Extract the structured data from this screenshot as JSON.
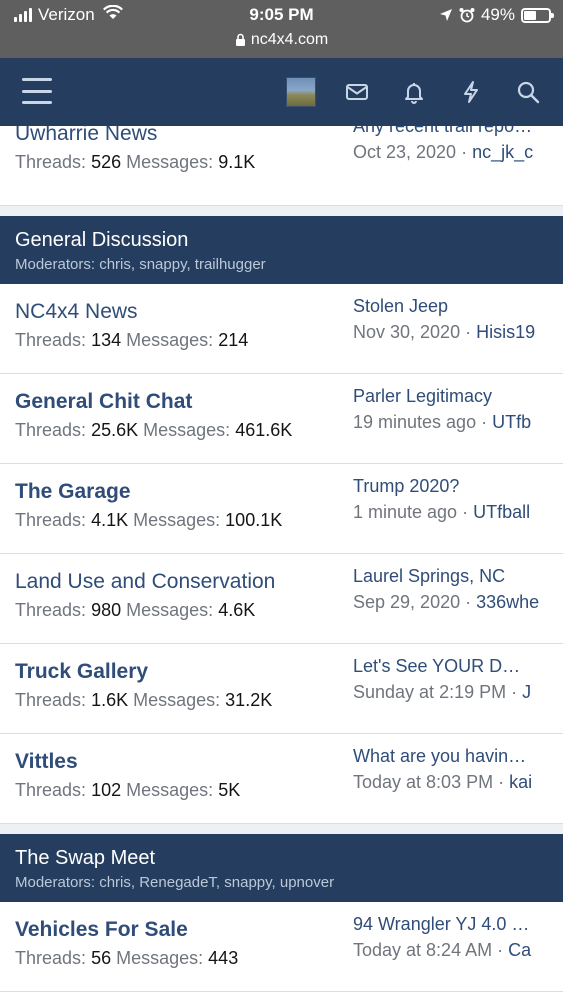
{
  "status_bar": {
    "carrier": "Verizon",
    "time": "9:05 PM",
    "url": "nc4x4.com",
    "battery": "49%",
    "battery_level": 0.49
  },
  "navbar": {
    "icons": [
      "menu-icon",
      "avatar",
      "inbox-icon",
      "bell-icon",
      "bolt-icon",
      "search-icon"
    ]
  },
  "colors": {
    "header_bg": "#253e60",
    "link": "#2f4d78",
    "muted": "#70757d",
    "status_bg": "#5f5f5f"
  },
  "labels": {
    "threads": "Threads:",
    "messages": "Messages:"
  },
  "forums_top": [
    {
      "title": "Uwharrie News",
      "threads": "526",
      "messages": "9.1K",
      "last_title": "Any recent trail repo…",
      "last_date": "Oct 23, 2020",
      "last_user": "nc_jk_c"
    }
  ],
  "categories": [
    {
      "title": "General Discussion",
      "moderators": "Moderators: chris, snappy, trailhugger",
      "forums": [
        {
          "title": "NC4x4 News",
          "threads": "134",
          "messages": "214",
          "last_title": "Stolen Jeep",
          "last_date": "Nov 30, 2020",
          "last_user": "Hisis19"
        },
        {
          "title": "General Chit Chat",
          "threads": "25.6K",
          "messages": "461.6K",
          "last_title": "Parler Legitimacy",
          "last_date": "19 minutes ago",
          "last_user": "UTfb"
        },
        {
          "title": "The Garage",
          "threads": "4.1K",
          "messages": "100.1K",
          "last_title": "Trump 2020?",
          "last_date": "1 minute ago",
          "last_user": "UTfball"
        },
        {
          "title": "Land Use and Conservation",
          "threads": "980",
          "messages": "4.6K",
          "last_title": "Laurel Springs, NC",
          "last_date": "Sep 29, 2020",
          "last_user": "336whe"
        },
        {
          "title": "Truck Gallery",
          "threads": "1.6K",
          "messages": "31.2K",
          "last_title": "Let's See YOUR D…",
          "last_date": "Sunday at 2:19 PM",
          "last_user": "J"
        },
        {
          "title": "Vittles",
          "threads": "102",
          "messages": "5K",
          "last_title": "What are you havin…",
          "last_date": "Today at 8:03 PM",
          "last_user": "kai"
        }
      ]
    },
    {
      "title": "The Swap Meet",
      "moderators": "Moderators: chris, RenegadeT, snappy, upnover",
      "forums": [
        {
          "title": "Vehicles For Sale",
          "threads": "56",
          "messages": "443",
          "last_title": "94 Wrangler YJ 4.0 …",
          "last_date": "Today at 8:24 AM",
          "last_user": "Ca"
        }
      ]
    }
  ]
}
